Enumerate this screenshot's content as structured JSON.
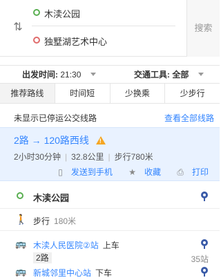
{
  "route": {
    "start": "木渎公园",
    "end": "独墅湖艺术中心",
    "search_label": "搜索"
  },
  "options": {
    "departure_label": "出发时间:",
    "departure_value": "21:30",
    "tool_label": "交通工具:",
    "tool_value": "全部"
  },
  "tabs": [
    "推荐路线",
    "时间短",
    "少换乘",
    "少步行"
  ],
  "notice": {
    "text": "未显示已停运公交线路",
    "link": "查看全部线路"
  },
  "plan": {
    "title": "2路 → 120路西线",
    "duration": "2小时30分钟",
    "distance": "32.8公里",
    "walk": "步行780米",
    "send_label": "发送到手机",
    "fav_label": "收藏",
    "print_label": "打印"
  },
  "steps": {
    "start_name": "木渎公园",
    "walk_label": "步行",
    "walk_dist": "180米",
    "board_stop": "木渎人民医院②站",
    "board_action": "上车",
    "bus_line": "2路",
    "stop_count": "35站",
    "alight_stop": "新城邻里中心站",
    "alight_action": "下车"
  },
  "colors": {
    "accent": "#3385ff",
    "card_bg": "#e9f2ff",
    "start_green": "#5aaf52",
    "end_red": "#e06b6b",
    "warning": "#f5a623",
    "pin": "#3a5ba8"
  }
}
